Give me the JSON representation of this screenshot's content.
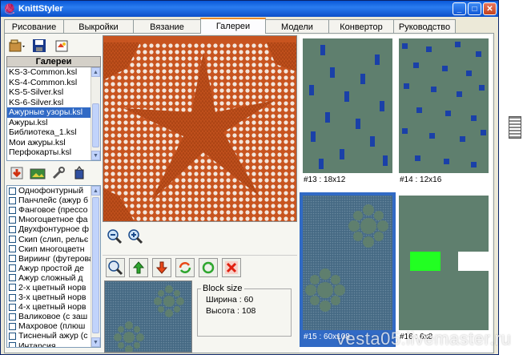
{
  "window": {
    "title": "KnittStyler",
    "minimize": "_",
    "maximize": "□",
    "close": "✕"
  },
  "tabs": [
    {
      "label": "Рисование"
    },
    {
      "label": "Выкройки"
    },
    {
      "label": "Вязание"
    },
    {
      "label": "Галереи",
      "active": true
    },
    {
      "label": "Модели"
    },
    {
      "label": "Конвертор"
    },
    {
      "label": "Руководство"
    }
  ],
  "galleries": {
    "header": "Галереи",
    "items": [
      "KS-3-Common.ksl",
      "KS-4-Common.ksl",
      "KS-5-Silver.ksl",
      "KS-6-Silver.ksl",
      "Ажурные узоры.ksl",
      "Ажуры.ksl",
      "Библиотека_1.ksl",
      "Мои ажуры.ksl",
      "Перфокарты.ksl"
    ],
    "selected_index": 4
  },
  "patterns": [
    "Однофонтурный",
    "Панчлейс (ажур б",
    "Фанговое (прессо",
    "Многоцветное фа",
    "Двухфонтурное ф",
    "Скип (слип, рельє",
    "Скип многоцветн",
    "Вириинг (футерова",
    "Ажур простой де",
    "Ажур сложный д",
    "2-х цветный норв",
    "3-х цветный норв",
    "4-х цветный норв",
    "Валиковое (с заш",
    "Махровое (плюш",
    "Тисненый ажур (с",
    "Интарсия"
  ],
  "block": {
    "legend": "Block size",
    "width_label": "Ширина :",
    "width_value": "60",
    "height_label": "Высота :",
    "height_value": "108"
  },
  "thumbnails": [
    {
      "caption": "#13 : 18x12"
    },
    {
      "caption": "#14 : 12x16"
    },
    {
      "caption": "#15 : 60x108",
      "selected": true
    },
    {
      "caption": "#16 : 6x8"
    }
  ],
  "watermark": "vesta05.livemaster.ru",
  "colors": {
    "pattern_bg": "#5f7f6e",
    "pattern_block": "#1a40a8",
    "knit_orange": "#c8541f",
    "selection": "#316ac5",
    "green_block": "#22ff22",
    "white_block": "#ffffff"
  }
}
